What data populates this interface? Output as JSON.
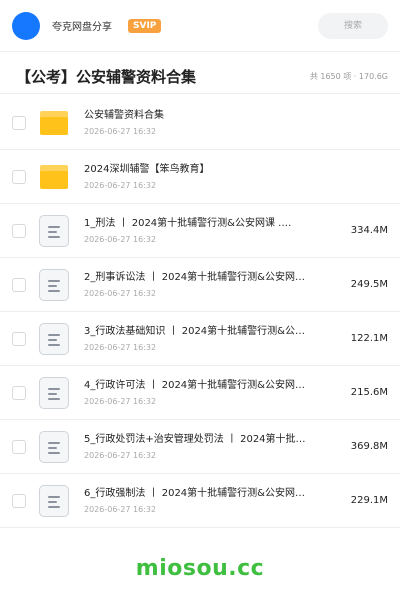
{
  "header": {
    "brand": "夸克网盘分享",
    "badge": "SVIP",
    "search_placeholder": "搜索"
  },
  "title": {
    "text": "【公考】公安辅警资料合集",
    "meta": "共 1650 项 · 170.6G"
  },
  "files": [
    {
      "type": "folder",
      "name": "公安辅警资料合集",
      "date": "2026-06-27 16:32",
      "size": ""
    },
    {
      "type": "folder",
      "name": "2024深圳辅警【笨鸟教育】",
      "date": "2026-06-27 16:32",
      "size": ""
    },
    {
      "type": "doc",
      "name": "1_刑法 丨 2024第十批辅警行测&公安网课 .…",
      "date": "2026-06-27 16:32",
      "size": "334.4M"
    },
    {
      "type": "doc",
      "name": "2_刑事诉讼法 丨 2024第十批辅警行测&公安网…",
      "date": "2026-06-27 16:32",
      "size": "249.5M"
    },
    {
      "type": "doc",
      "name": "3_行政法基础知识 丨 2024第十批辅警行测&公…",
      "date": "2026-06-27 16:32",
      "size": "122.1M"
    },
    {
      "type": "doc",
      "name": "4_行政许可法 丨 2024第十批辅警行测&公安网…",
      "date": "2026-06-27 16:32",
      "size": "215.6M"
    },
    {
      "type": "doc",
      "name": "5_行政处罚法+治安管理处罚法 丨 2024第十批…",
      "date": "2026-06-27 16:32",
      "size": "369.8M"
    },
    {
      "type": "doc",
      "name": "6_行政强制法 丨 2024第十批辅警行测&公安网…",
      "date": "2026-06-27 16:32",
      "size": "229.1M"
    }
  ],
  "watermark": "miosou.cc",
  "colors": {
    "accent": "#1677ff",
    "badge": "#f7a23e",
    "folder": "#ffc21a",
    "watermark": "#3fbf3f"
  },
  "icons": {
    "folder": "folder-icon",
    "doc": "document-icon"
  }
}
